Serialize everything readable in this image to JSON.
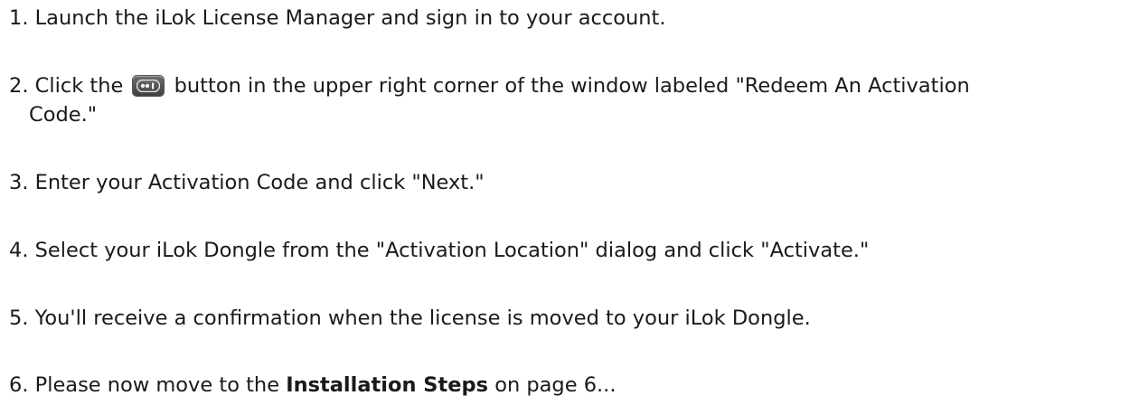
{
  "steps": [
    {
      "num": "1.",
      "text": "Launch the iLok License Manager and sign in to your account."
    },
    {
      "num": "2.",
      "pre": "Click the",
      "post": "button in the upper right corner of the window labeled \"Redeem An Activation",
      "cont": "Code.\"",
      "icon": "redeem-activation-code-icon"
    },
    {
      "num": "3.",
      "text": "Enter your Activation Code and click \"Next.\""
    },
    {
      "num": "4.",
      "text": "Select your iLok Dongle from the \"Activation Location\" dialog and click \"Activate.\""
    },
    {
      "num": "5.",
      "text": "You'll receive a confirmation when the license is moved to your iLok Dongle."
    },
    {
      "num": "6.",
      "pre": "Please now move to the",
      "bold": "Installation Steps",
      "post": "on page 6..."
    }
  ]
}
